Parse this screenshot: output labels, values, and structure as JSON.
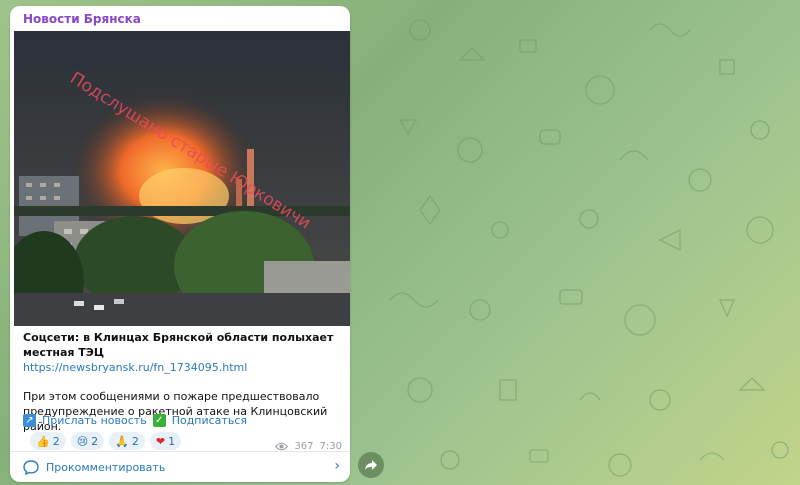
{
  "post": {
    "channel_name": "Новости Брянска",
    "watermark": "Подслушано старые Юрковичи",
    "headline": "Соцсети: в Клинцах Брянской области полыхает местная ТЭЦ",
    "link": "https://newsbryansk.ru/fn_1734095.html",
    "paragraph": "При этом сообщениями о пожаре предшествовало предупреждение о ракетной атаке на Клинцовский район.",
    "actions": {
      "send_news": "Прислать новость",
      "subscribe": "Подписаться"
    },
    "reactions": [
      {
        "icon": "👍",
        "count": "2"
      },
      {
        "icon": "😢",
        "count": "2"
      },
      {
        "icon": "🙏",
        "count": "2"
      },
      {
        "icon": "❤",
        "count": "1"
      }
    ],
    "views": "367",
    "time": "7:30",
    "comment_label": "Прокомментировать"
  },
  "colors": {
    "channel": "#8a46c7",
    "link": "#2a7ab9",
    "background": "#9ec48a"
  }
}
